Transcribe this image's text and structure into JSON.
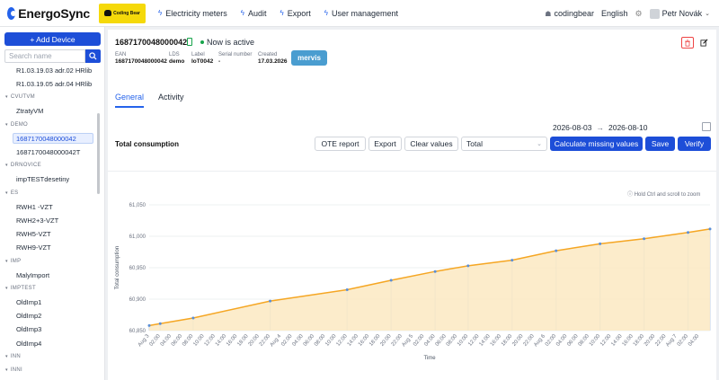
{
  "header": {
    "app_name": "EnergoSync",
    "brand_badge": "Coding Bear",
    "nav": [
      {
        "label": "Electricity meters"
      },
      {
        "label": "Audit"
      },
      {
        "label": "Export"
      },
      {
        "label": "User management"
      }
    ],
    "org": "codingbear",
    "language": "English",
    "user": "Petr Novák"
  },
  "sidebar": {
    "add_button": "+ Add Device",
    "search_placeholder": "Search name",
    "tree": [
      {
        "kind": "leaf",
        "label": "R1.03.19.03 adr.02 HRlib"
      },
      {
        "kind": "leaf",
        "label": "R1.03.19.05 adr.04 HRlib"
      },
      {
        "kind": "group",
        "label": "CVUTVM"
      },
      {
        "kind": "leaf",
        "label": "ZtratyVM"
      },
      {
        "kind": "group",
        "label": "DEMO"
      },
      {
        "kind": "leaf",
        "label": "1687170048000042",
        "selected": true
      },
      {
        "kind": "leaf",
        "label": "1687170048000042T"
      },
      {
        "kind": "group",
        "label": "DRNOVICE"
      },
      {
        "kind": "leaf",
        "label": "impTESTdesetiny"
      },
      {
        "kind": "group",
        "label": "ES"
      },
      {
        "kind": "leaf",
        "label": "RWH1 -VZT"
      },
      {
        "kind": "leaf",
        "label": "RWH2+3-VZT"
      },
      {
        "kind": "leaf",
        "label": "RWH5-VZT"
      },
      {
        "kind": "leaf",
        "label": "RWH9-VZT"
      },
      {
        "kind": "group",
        "label": "IMP"
      },
      {
        "kind": "leaf",
        "label": "MalyImport"
      },
      {
        "kind": "group",
        "label": "IMPTEST"
      },
      {
        "kind": "leaf",
        "label": "OldImp1"
      },
      {
        "kind": "leaf",
        "label": "OldImp2"
      },
      {
        "kind": "leaf",
        "label": "OldImp3"
      },
      {
        "kind": "leaf",
        "label": "OldImp4"
      },
      {
        "kind": "group",
        "label": "INN"
      },
      {
        "kind": "group",
        "label": "INNI"
      },
      {
        "kind": "group",
        "label": "JIRINY"
      }
    ]
  },
  "device": {
    "id": "1687170048000042",
    "status": "Now is active",
    "status_color": "#16a34a",
    "meta": [
      {
        "label": "EAN",
        "value": "1687170048000042"
      },
      {
        "label": "LDS",
        "value": "demo"
      },
      {
        "label": "Label",
        "value": "IoT0042"
      },
      {
        "label": "Serial number",
        "value": "-"
      },
      {
        "label": "Created",
        "value": "17.03.2026"
      }
    ],
    "integration_badge": "mervis"
  },
  "tabs": [
    {
      "label": "General",
      "active": true
    },
    {
      "label": "Activity",
      "active": false
    }
  ],
  "controls": {
    "date_from": "2026-08-03",
    "date_to": "2026-08-10",
    "section_title": "Total consumption",
    "ote_report": "OTE report",
    "export": "Export",
    "clear_values": "Clear values",
    "select_value": "Total",
    "calculate_missing": "Calculate missing values",
    "save": "Save",
    "verify": "Verify",
    "zoom_hint": "Hold Ctrl and scroll to zoom"
  },
  "colors": {
    "accent": "#1d4ed8",
    "line": "#f5a623",
    "area": "#fbe9c2"
  },
  "chart_data": {
    "type": "area",
    "xlabel": "Time",
    "ylabel": "Total consumption",
    "ylim": [
      60850,
      61050
    ],
    "yticks": [
      60850,
      60900,
      60950,
      61000,
      61050
    ],
    "x_tick_labels": [
      "Aug 3",
      "02:00",
      "04:00",
      "06:00",
      "08:00",
      "10:00",
      "12:00",
      "14:00",
      "16:00",
      "18:00",
      "20:00",
      "22:00",
      "Aug 4",
      "02:00",
      "04:00",
      "06:00",
      "08:00",
      "10:00",
      "12:00",
      "14:00",
      "16:00",
      "18:00",
      "20:00",
      "22:00",
      "Aug 5",
      "02:00",
      "04:00",
      "06:00",
      "08:00",
      "10:00",
      "12:00",
      "14:00",
      "16:00",
      "18:00",
      "20:00",
      "22:00",
      "Aug 6",
      "02:00",
      "04:00",
      "06:00",
      "08:00",
      "10:00",
      "12:00",
      "14:00",
      "16:00",
      "18:00",
      "20:00",
      "22:00",
      "Aug 7",
      "02:00",
      "04:00"
    ],
    "x_range_hours": [
      0,
      102
    ],
    "series": [
      {
        "x_hours": [
          0,
          2,
          8,
          22,
          36,
          44,
          52,
          58,
          66,
          74,
          82,
          90,
          98,
          108,
          118,
          128,
          142,
          158,
          172,
          180
        ],
        "values": [
          60858,
          60861,
          60870,
          60897,
          60915,
          60930,
          60944,
          60953,
          60962,
          60977,
          60988,
          60996,
          61006,
          61020,
          61030,
          61039,
          61046,
          61048,
          61050,
          61050
        ]
      }
    ]
  }
}
